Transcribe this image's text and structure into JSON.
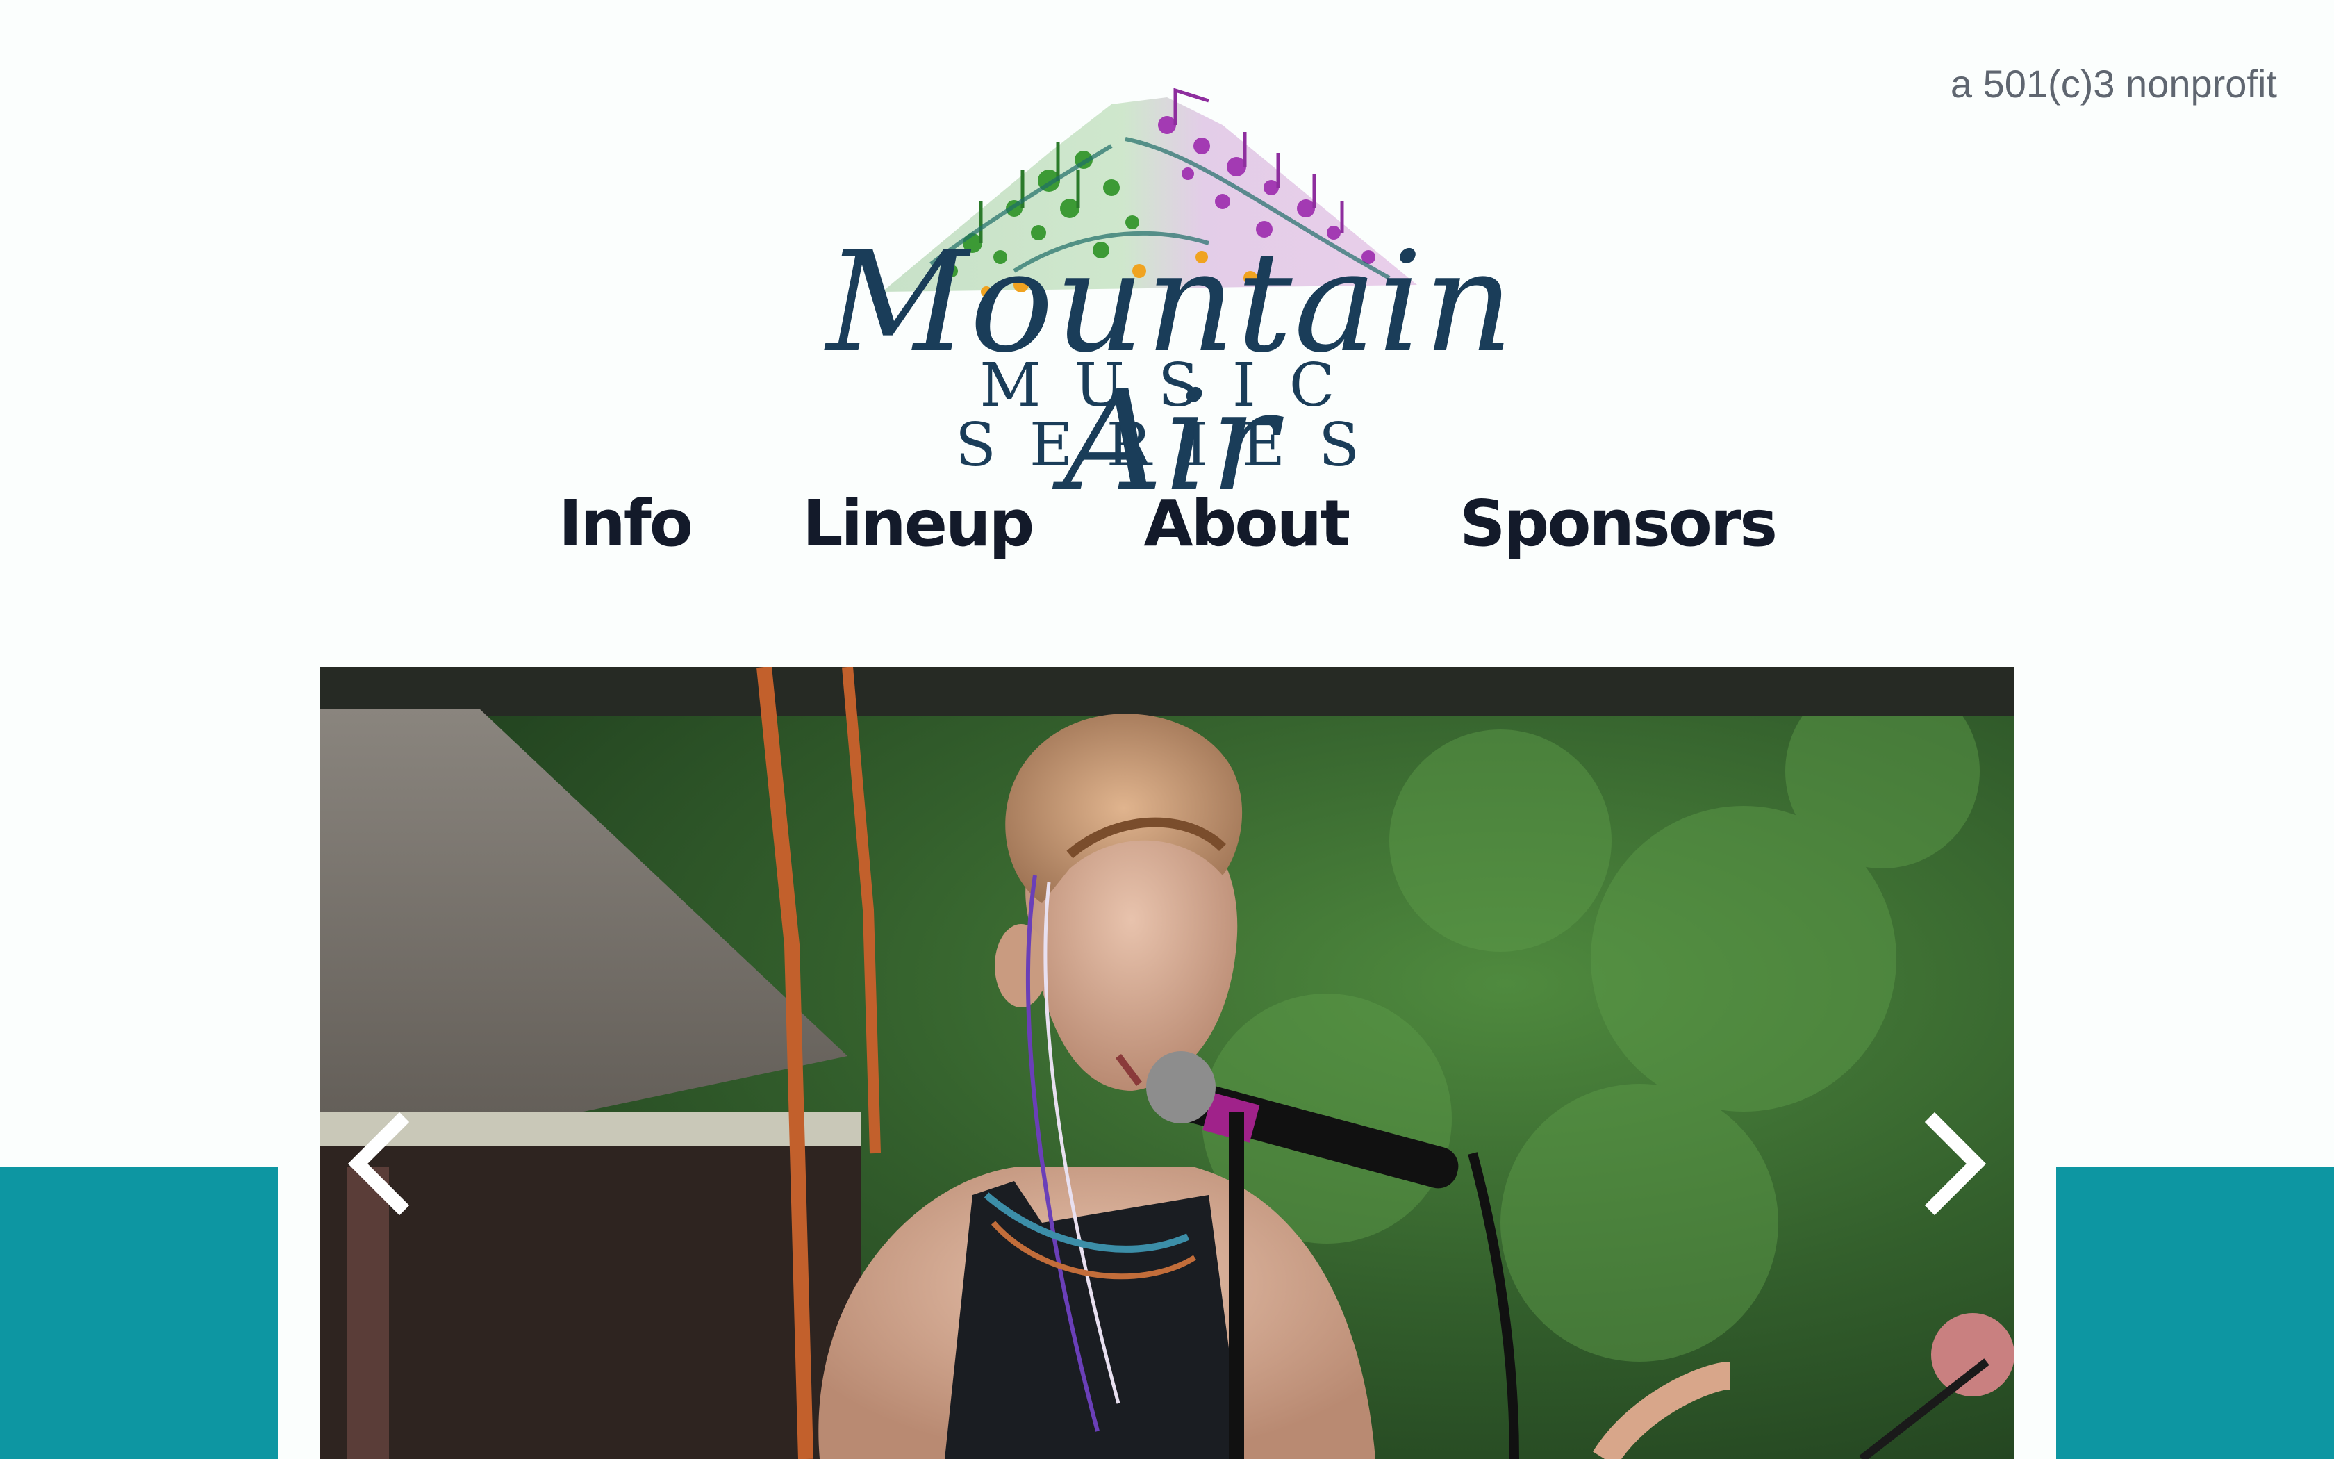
{
  "header": {
    "tagline": "a 501(c)3 nonprofit"
  },
  "logo": {
    "wordmark": "Mountain Air",
    "subtitle": "MUSIC SERIES"
  },
  "nav": {
    "items": [
      {
        "label": "Info"
      },
      {
        "label": "Lineup"
      },
      {
        "label": "About"
      },
      {
        "label": "Sponsors"
      }
    ]
  },
  "carousel": {
    "prev_icon": "chevron-left-icon",
    "next_icon": "chevron-right-icon"
  },
  "colors": {
    "background": "#fbfefd",
    "accent_teal": "#0d96a2",
    "nav_text": "#131a2a",
    "logo_text": "#1a3d59",
    "tagline_text": "#5f6670"
  }
}
